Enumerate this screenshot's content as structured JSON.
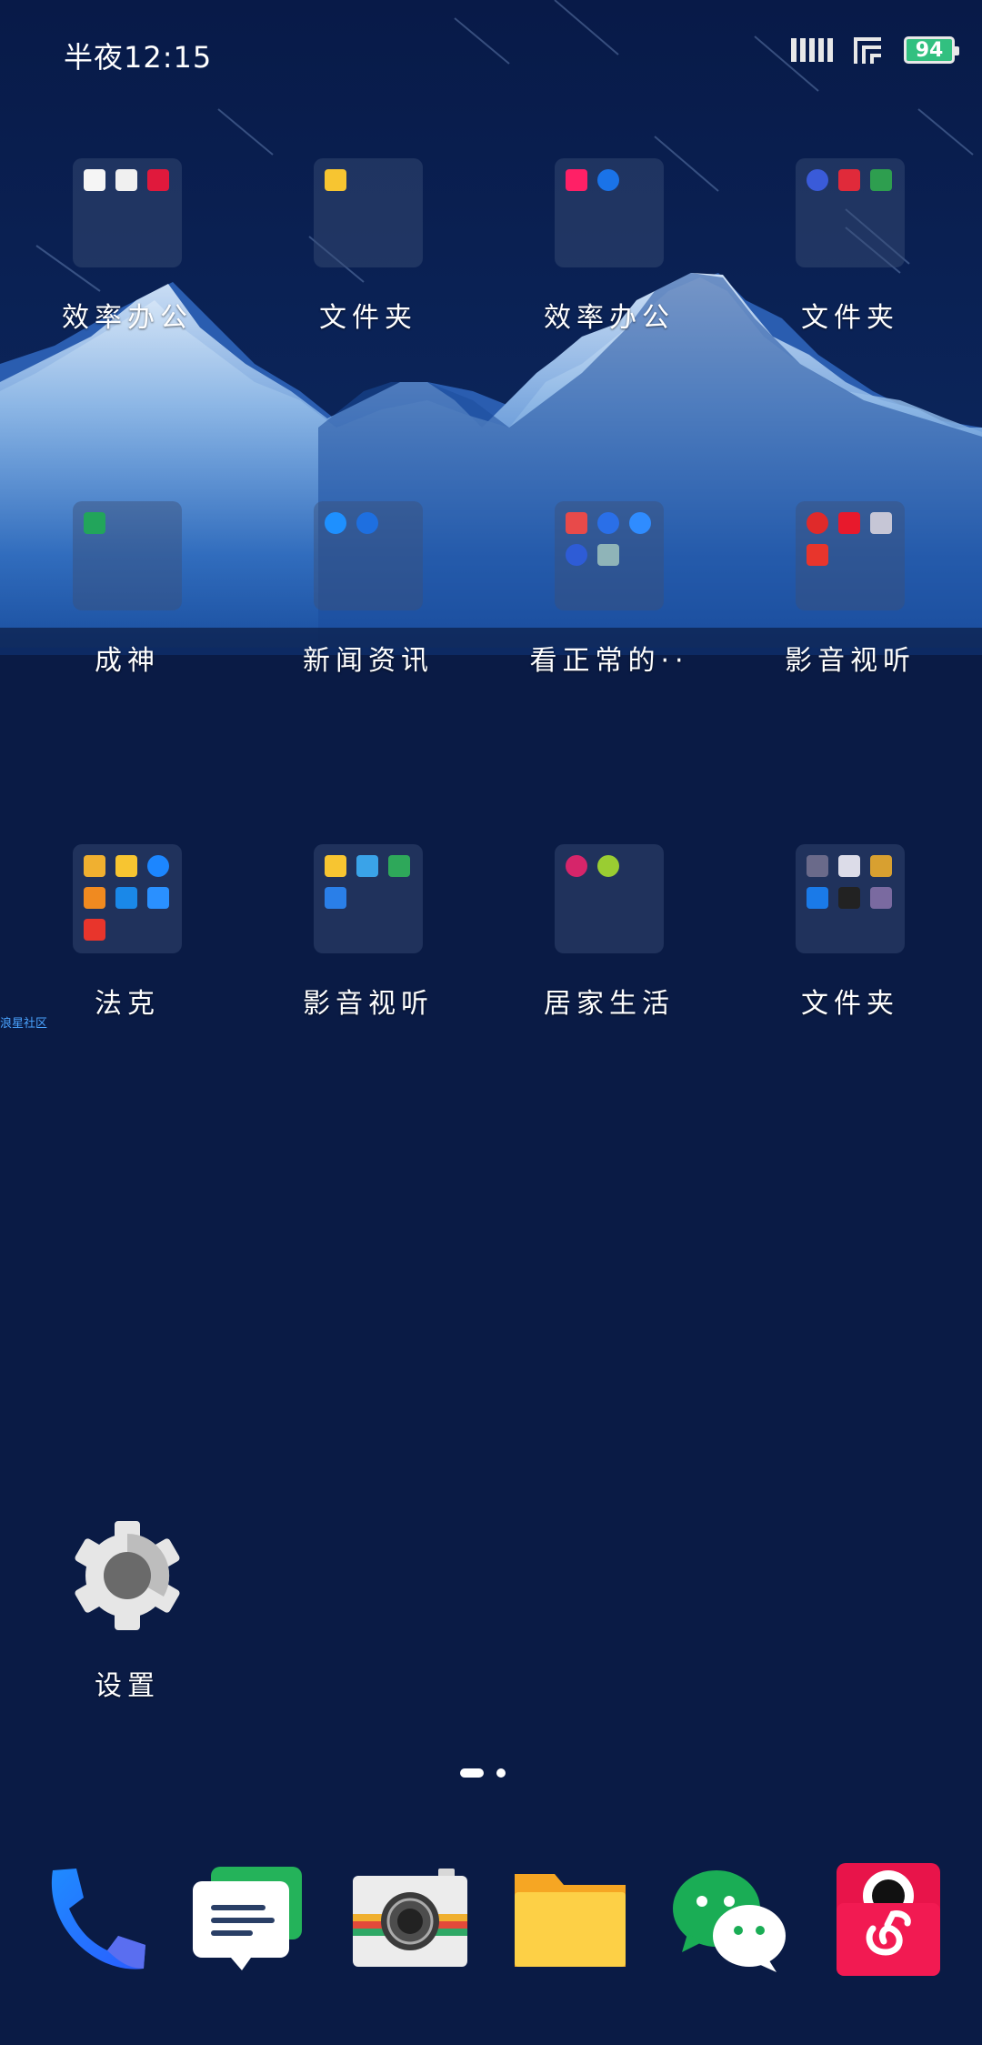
{
  "status_bar": {
    "time": "半夜12:15",
    "battery_level": "94"
  },
  "grid": {
    "rows": [
      [
        {
          "label": "效率办公",
          "icons": [
            "#f5f5f5",
            "#f0f0f0",
            "#e0193c"
          ]
        },
        {
          "label": "文件夹",
          "icons": [
            "#f7c531"
          ]
        },
        {
          "label": "效率办公",
          "icons": [
            "#ff2066",
            "#1a73e8"
          ]
        },
        {
          "label": "文件夹",
          "icons": [
            "#3a5bd9",
            "#e02a3a",
            "#2e9e4f"
          ]
        }
      ],
      [
        {
          "label": "成神",
          "icons": [
            "#22a55b"
          ]
        },
        {
          "label": "新闻资讯",
          "icons": [
            "#1e90ff",
            "#1e6fe0"
          ]
        },
        {
          "label": "看正常的··",
          "icons": [
            "#e84a4a",
            "#2a6fe8",
            "#2f8cff",
            "#2e5cd6",
            "#8fb4b8"
          ]
        },
        {
          "label": "影音视听",
          "icons": [
            "#e02a2a",
            "#e8192c",
            "#c6c6d6",
            "#e8352c"
          ]
        }
      ],
      [
        {
          "label": "法克",
          "icons": [
            "#f0b030",
            "#f7c531",
            "#1c86ff",
            "#f08a20",
            "#1a88e8",
            "#2a90ff",
            "#e8352c"
          ]
        },
        {
          "label": "影音视听",
          "icons": [
            "#f7c531",
            "#3aa3e8",
            "#2ea85a",
            "#2a7fe8"
          ]
        },
        {
          "label": "居家生活",
          "icons": [
            "#d6256a",
            "#9acd32"
          ]
        },
        {
          "label": "文件夹",
          "icons": [
            "#6a6a8a",
            "#dcdce8",
            "#d8a030",
            "#1a7ae8",
            "#222222",
            "#7a6aa0"
          ]
        }
      ]
    ]
  },
  "side_tag": "浪星社区",
  "settings_app": {
    "label": "设置"
  },
  "dock": {
    "items": [
      "phone",
      "messages",
      "camera",
      "files",
      "wechat",
      "netease-music"
    ]
  },
  "colors": {
    "background": "#0a1b45",
    "battery": "#32c080",
    "accent": "#4aa3ff"
  }
}
